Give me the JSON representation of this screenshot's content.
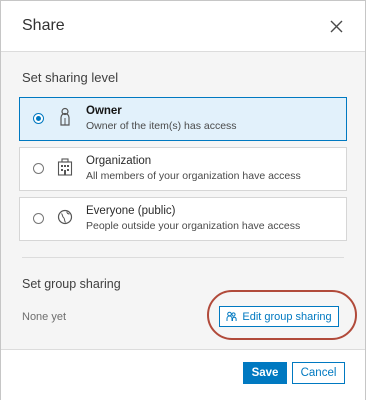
{
  "dialog": {
    "title": "Share"
  },
  "sharing_level": {
    "label": "Set sharing level",
    "options": [
      {
        "title": "Owner",
        "description": "Owner of the item(s) has access",
        "icon": "person-icon",
        "selected": true
      },
      {
        "title": "Organization",
        "description": "All members of your organization have access",
        "icon": "organization-icon",
        "selected": false
      },
      {
        "title": "Everyone (public)",
        "description": "People outside your organization have access",
        "icon": "globe-icon",
        "selected": false
      }
    ]
  },
  "group_sharing": {
    "label": "Set group sharing",
    "status": "None yet",
    "edit_button_label": "Edit group sharing"
  },
  "footer": {
    "save_label": "Save",
    "cancel_label": "Cancel"
  },
  "colors": {
    "accent": "#0079c1",
    "selected_bg": "#e2f1fb",
    "highlight_ring": "#b14a3a"
  }
}
